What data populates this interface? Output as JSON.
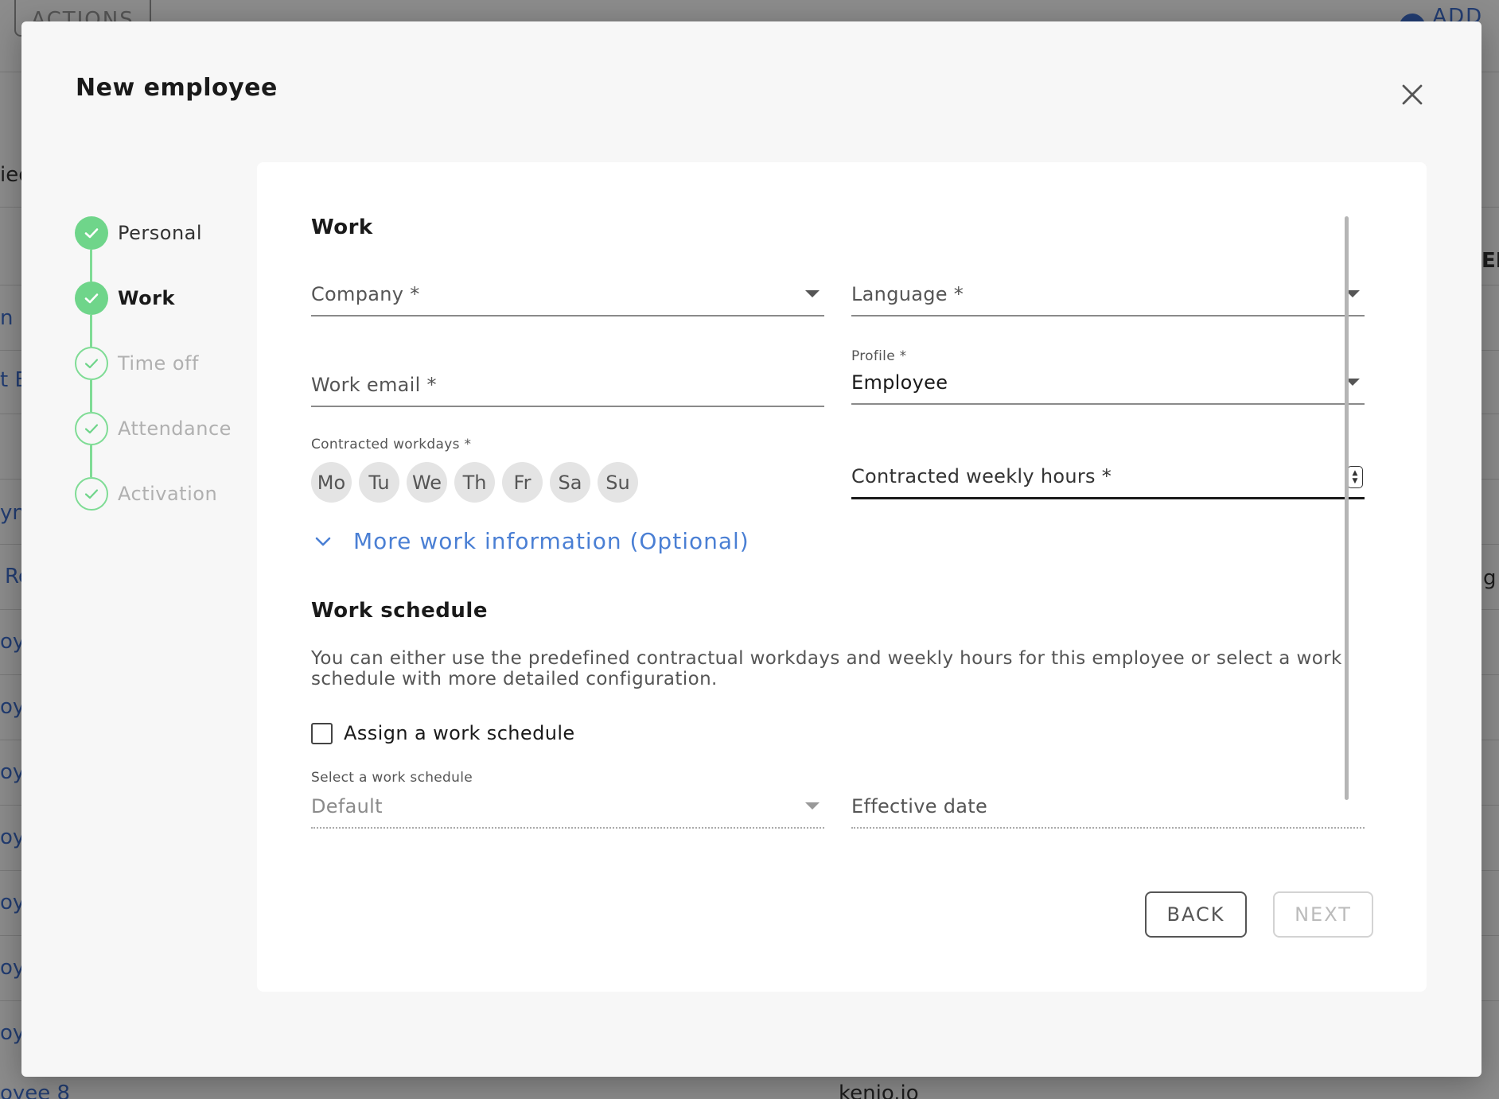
{
  "background": {
    "actions_label": "ACTIONS",
    "add_label": "ADD E",
    "row_fragments": [
      "ied",
      "n",
      "t B",
      "yn",
      "Re",
      "oye",
      "oye",
      "oye",
      "oye",
      "oye",
      "oye",
      "oye",
      "oyee 8"
    ],
    "right_fragments": [
      "EN",
      "g"
    ],
    "bottom_fragment": "kenjo.io"
  },
  "modal": {
    "title": "New employee",
    "close_icon": "close-icon"
  },
  "stepper": {
    "steps": [
      {
        "label": "Personal",
        "state": "done"
      },
      {
        "label": "Work",
        "state": "active"
      },
      {
        "label": "Time off",
        "state": "pending"
      },
      {
        "label": "Attendance",
        "state": "pending"
      },
      {
        "label": "Activation",
        "state": "pending"
      }
    ],
    "colors": {
      "done": "#6fd58a",
      "pending_ring": "#7fdc95"
    }
  },
  "work": {
    "title": "Work",
    "company": {
      "label": "Company *",
      "value": ""
    },
    "language": {
      "label": "Language *",
      "value": ""
    },
    "work_email": {
      "label": "Work email *",
      "value": ""
    },
    "profile": {
      "label": "Profile *",
      "value": "Employee"
    },
    "contracted_workdays": {
      "label": "Contracted workdays *",
      "days": [
        "Mo",
        "Tu",
        "We",
        "Th",
        "Fr",
        "Sa",
        "Su"
      ]
    },
    "contracted_weekly_hours": {
      "label": "Contracted weekly hours *",
      "value": ""
    },
    "more_info_label": "More work information (Optional)"
  },
  "work_schedule": {
    "title": "Work schedule",
    "description": "You can either use the predefined contractual workdays and weekly hours for this employee or select a work schedule with more detailed configuration.",
    "assign_label": "Assign a work schedule",
    "assign_checked": false,
    "select_schedule": {
      "label": "Select a work schedule",
      "value": "Default"
    },
    "effective_date": {
      "label": "Effective date",
      "value": ""
    }
  },
  "actions": {
    "back_label": "BACK",
    "next_label": "NEXT"
  },
  "colors": {
    "accent_link": "#4a7fd4",
    "success": "#6fd58a"
  }
}
